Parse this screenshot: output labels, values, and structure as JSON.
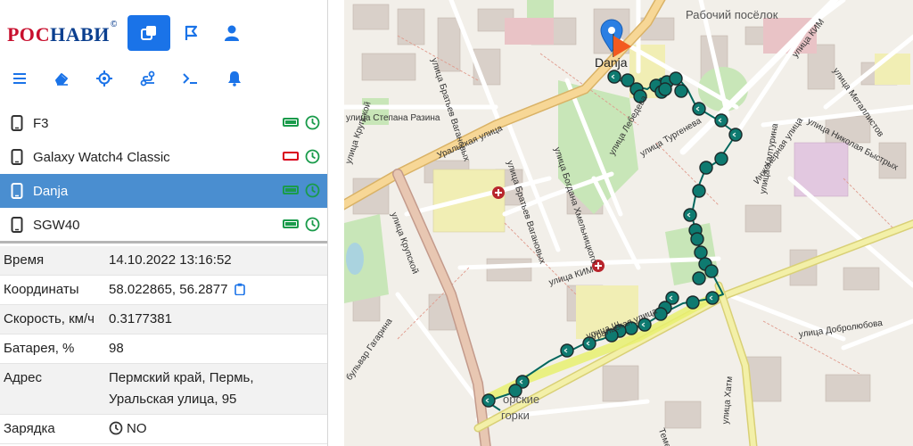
{
  "app": {
    "logo_part1": "РОС",
    "logo_part2": "НАВИ",
    "logo_mark": "©"
  },
  "toolbar_top": [
    {
      "icon": "objects-icon",
      "active": true
    },
    {
      "icon": "flag-icon",
      "active": false
    },
    {
      "icon": "user-icon",
      "active": false
    }
  ],
  "toolbar_tools": [
    "menu-icon",
    "eraser-icon",
    "locate-icon",
    "route-icon",
    "terminal-icon",
    "bell-icon"
  ],
  "devices": [
    {
      "name": "F3",
      "battery": "full",
      "active": false
    },
    {
      "name": "Galaxy Watch4 Classic",
      "battery": "empty",
      "active": false
    },
    {
      "name": "Danja",
      "battery": "full",
      "active": true
    },
    {
      "name": "SGW40",
      "battery": "full",
      "active": false
    }
  ],
  "properties": {
    "time_label": "Время",
    "time_value": "14.10.2022 13:16:52",
    "coords_label": "Координаты",
    "coords_value": "58.022865, 56.2877",
    "speed_label": "Скорость, км/ч",
    "speed_value": "0.3177381",
    "battery_label": "Батарея, %",
    "battery_value": "98",
    "address_label": "Адрес",
    "address_line1": "Пермский край, Пермь,",
    "address_line2": "Уральская улица, 95",
    "charging_label": "Зарядка",
    "charging_value": "NO"
  },
  "map": {
    "marker_label": "Danja",
    "labels": {
      "district_1": "Рабочий посёлок",
      "district_2": "орские",
      "district_3": "горки",
      "street_uralskaya": "Уральская улица",
      "street_uralskaya2": "Уральская улица",
      "street_kim": "улица КИМ",
      "street_kim2": "улица КИМ",
      "street_krupskoy": "улица Крупской",
      "street_krupskoy2": "улица Крупской",
      "street_razina": "улица Степана Разина",
      "street_lebedeva": "улица Лебедева",
      "street_turgeneva": "улица Тургенева",
      "street_zamyatina": "улица Богдана Хмельницкого",
      "street_vaganovyh": "улица Братьев Вагановых",
      "street_vaganovyh2": "улица Братьев Вагановых",
      "street_khaturina": "улица Халтурина",
      "street_inzhenernaya": "Инженерная улица",
      "street_bystryh": "улица Николая Быстрых",
      "street_metallistov": "улица Металлистов",
      "street_dobrolyubova": "улица Добролюбова",
      "street_gagarina": "бульвар Гагарина",
      "street_shiryaeva": "улица Ш",
      "street_tem": "Темени",
      "street_khatm": "улица Хатм"
    },
    "track_color": "#007a6e",
    "route_color": "#e8f070"
  }
}
